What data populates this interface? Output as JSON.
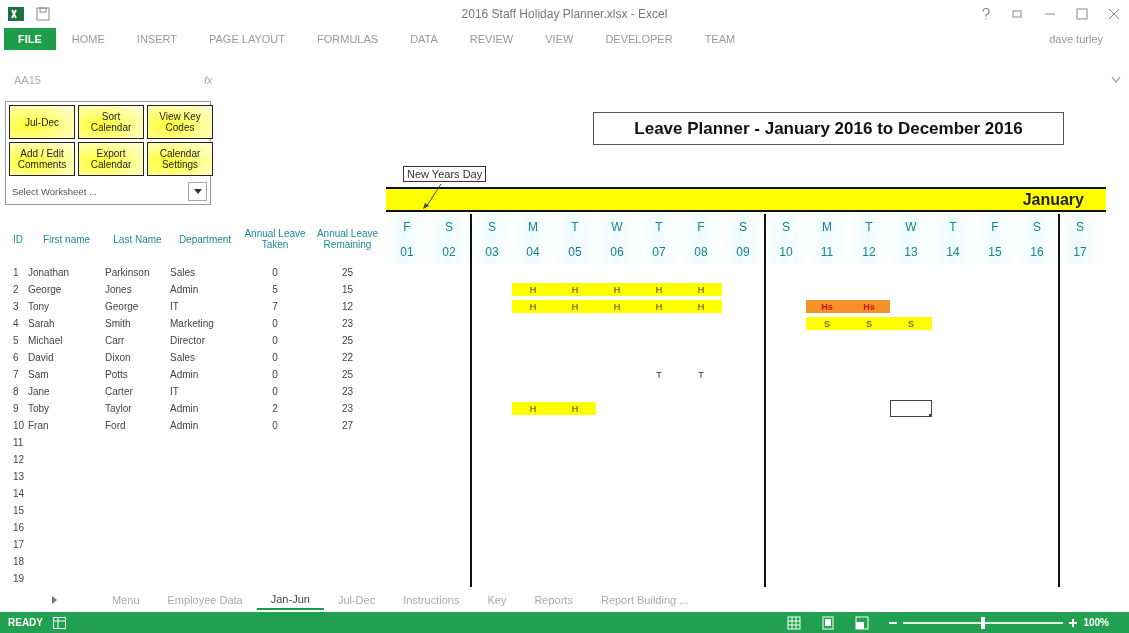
{
  "window": {
    "title": "2016 Staff Holiday Planner.xlsx - Excel",
    "user": "dave turley"
  },
  "ribbon_tabs": [
    {
      "label": "FILE",
      "selected": true
    },
    {
      "label": "HOME",
      "selected": false
    },
    {
      "label": "INSERT",
      "selected": false
    },
    {
      "label": "PAGE LAYOUT",
      "selected": false
    },
    {
      "label": "FORMULAS",
      "selected": false
    },
    {
      "label": "DATA",
      "selected": false
    },
    {
      "label": "REVIEW",
      "selected": false
    },
    {
      "label": "VIEW",
      "selected": false
    },
    {
      "label": "DEVELOPER",
      "selected": false
    },
    {
      "label": "TEAM",
      "selected": false
    }
  ],
  "formula_bar": {
    "name_box": "AA15",
    "fx": "fx"
  },
  "control_panel": {
    "buttons": [
      "Jul-Dec",
      "Sort Calendar",
      "View Key Codes",
      "Add / Edit Comments",
      "Export Calendar",
      "Calendar Settings"
    ],
    "dropdown": {
      "placeholder": "Select Worksheet ..."
    }
  },
  "planner": {
    "title": "Leave Planner - January 2016 to December 2016",
    "comment": "New Years Day",
    "month": "January"
  },
  "table": {
    "columns": [
      "ID",
      "First name",
      "Last Name",
      "Department",
      "Annual Leave Taken",
      "Annual Leave Remaining"
    ],
    "rows": [
      {
        "id": "1",
        "first_name": "Jonathan",
        "last_name": "Parkinson",
        "department": "Sales",
        "taken": "0",
        "remaining": "25"
      },
      {
        "id": "2",
        "first_name": "George",
        "last_name": "Jones",
        "department": "Admin",
        "taken": "5",
        "remaining": "15",
        "calendar": [
          {
            "selected": false
          },
          {
            "selected": false
          },
          {
            "selected": false
          },
          {
            "code": "H",
            "color": "#ffff00",
            "selected": false
          },
          {
            "code": "H",
            "color": "#ffff00",
            "selected": false
          },
          {
            "code": "H",
            "color": "#ffff00",
            "selected": false
          },
          {
            "code": "H",
            "color": "#ffff00",
            "selected": false
          },
          {
            "code": "H",
            "color": "#ffff00",
            "selected": false
          },
          {
            "selected": false
          },
          {
            "selected": false
          },
          {
            "selected": false
          },
          {
            "selected": false
          },
          {
            "selected": false
          },
          {
            "selected": false
          },
          {
            "selected": false
          },
          {
            "selected": false
          },
          {
            "selected": false
          }
        ]
      },
      {
        "id": "3",
        "first_name": "Tony",
        "last_name": "George",
        "department": "IT",
        "taken": "7",
        "remaining": "12",
        "calendar": [
          {
            "selected": false
          },
          {
            "selected": false
          },
          {
            "selected": false
          },
          {
            "code": "H",
            "color": "#ffff00",
            "selected": false
          },
          {
            "code": "H",
            "color": "#ffff00",
            "selected": false
          },
          {
            "code": "H",
            "color": "#ffff00",
            "selected": false
          },
          {
            "code": "H",
            "color": "#ffff00",
            "selected": false
          },
          {
            "code": "H",
            "color": "#ffff00",
            "selected": false
          },
          {
            "selected": false
          },
          {
            "selected": false
          },
          {
            "code": "Hs",
            "color": "#f5922a",
            "selected": false
          },
          {
            "code": "Hs",
            "color": "#f5922a",
            "selected": false
          },
          {
            "selected": false
          },
          {
            "selected": false
          },
          {
            "selected": false
          },
          {
            "selected": false
          },
          {
            "selected": false
          }
        ]
      },
      {
        "id": "4",
        "first_name": "Sarah",
        "last_name": "Smith",
        "department": "Marketing",
        "taken": "0",
        "remaining": "23",
        "calendar": [
          {
            "selected": false
          },
          {
            "selected": false
          },
          {
            "selected": false
          },
          {
            "selected": false
          },
          {
            "selected": false
          },
          {
            "selected": false
          },
          {
            "selected": false
          },
          {
            "selected": false
          },
          {
            "selected": false
          },
          {
            "selected": false
          },
          {
            "code": "S",
            "color": "#ffff00",
            "selected": false
          },
          {
            "code": "S",
            "color": "#ffff00",
            "selected": false
          },
          {
            "code": "S",
            "color": "#ffff00",
            "selected": false
          },
          {
            "selected": false
          },
          {
            "selected": false
          },
          {
            "selected": false
          },
          {
            "selected": false
          }
        ]
      },
      {
        "id": "5",
        "first_name": "Michael",
        "last_name": "Carr",
        "department": "Director",
        "taken": "0",
        "remaining": "25"
      },
      {
        "id": "6",
        "first_name": "David",
        "last_name": "Dixon",
        "department": "Sales",
        "taken": "0",
        "remaining": "22"
      },
      {
        "id": "7",
        "first_name": "Sam",
        "last_name": "Potts",
        "department": "Admin",
        "taken": "0",
        "remaining": "25",
        "calendar": [
          {
            "selected": false
          },
          {
            "selected": false
          },
          {
            "selected": false
          },
          {
            "selected": false
          },
          {
            "selected": false
          },
          {
            "selected": false
          },
          {
            "code": "T",
            "selected": false
          },
          {
            "code": "T",
            "selected": false
          },
          {
            "selected": false
          },
          {
            "selected": false
          },
          {
            "selected": false
          },
          {
            "selected": false
          },
          {
            "selected": false
          },
          {
            "selected": false
          },
          {
            "selected": false
          },
          {
            "selected": false
          },
          {
            "selected": false
          }
        ]
      },
      {
        "id": "8",
        "first_name": "Jane",
        "last_name": "Carter",
        "department": "IT",
        "taken": "0",
        "remaining": "23"
      },
      {
        "id": "9",
        "first_name": "Toby",
        "last_name": "Taylor",
        "department": "Admin",
        "taken": "2",
        "remaining": "23",
        "calendar": [
          {
            "selected": false
          },
          {
            "selected": false
          },
          {
            "selected": false
          },
          {
            "code": "H",
            "color": "#ffff00",
            "selected": false
          },
          {
            "code": "H",
            "color": "#ffff00",
            "selected": false
          },
          {
            "selected": false
          },
          {
            "selected": false
          },
          {
            "selected": false
          },
          {
            "selected": false
          },
          {
            "selected": false
          },
          {
            "selected": false
          },
          {
            "selected": false
          },
          {
            "selected": true
          },
          {
            "selected": false
          },
          {
            "selected": false
          },
          {
            "selected": false
          },
          {
            "selected": false
          }
        ]
      },
      {
        "id": "10",
        "first_name": "Fran",
        "last_name": "Ford",
        "department": "Admin",
        "taken": "0",
        "remaining": "27"
      },
      {
        "id": "11"
      },
      {
        "id": "12"
      },
      {
        "id": "13"
      },
      {
        "id": "14"
      },
      {
        "id": "15"
      },
      {
        "id": "16"
      },
      {
        "id": "17"
      },
      {
        "id": "18"
      },
      {
        "id": "19"
      }
    ]
  },
  "days": [
    {
      "letter": "F",
      "date": "01",
      "week_start": false
    },
    {
      "letter": "S",
      "date": "02",
      "week_start": false
    },
    {
      "letter": "S",
      "date": "03",
      "week_start": true
    },
    {
      "letter": "M",
      "date": "04",
      "week_start": false
    },
    {
      "letter": "T",
      "date": "05",
      "week_start": false
    },
    {
      "letter": "W",
      "date": "06",
      "week_start": false
    },
    {
      "letter": "T",
      "date": "07",
      "week_start": false
    },
    {
      "letter": "F",
      "date": "08",
      "week_start": false
    },
    {
      "letter": "S",
      "date": "09",
      "week_start": false
    },
    {
      "letter": "S",
      "date": "10",
      "week_start": true
    },
    {
      "letter": "M",
      "date": "11",
      "week_start": false
    },
    {
      "letter": "T",
      "date": "12",
      "week_start": false
    },
    {
      "letter": "W",
      "date": "13",
      "week_start": false
    },
    {
      "letter": "T",
      "date": "14",
      "week_start": false
    },
    {
      "letter": "F",
      "date": "15",
      "week_start": false
    },
    {
      "letter": "S",
      "date": "16",
      "week_start": false
    },
    {
      "letter": "S",
      "date": "17",
      "week_start": true
    }
  ],
  "sheet_tabs": [
    {
      "label": "Menu",
      "selected": false
    },
    {
      "label": "Employee Data",
      "selected": false
    },
    {
      "label": "Jan-Jun",
      "selected": true
    },
    {
      "label": "Jul-Dec",
      "selected": false
    },
    {
      "label": "Instructions",
      "selected": false
    },
    {
      "label": "Key",
      "selected": false
    },
    {
      "label": "Reports",
      "selected": false
    },
    {
      "label": "Report Building ...",
      "selected": false
    }
  ],
  "status_bar": {
    "status": "READY",
    "zoom": "100%",
    "zoom_level": {
      "level": 0.5
    }
  }
}
